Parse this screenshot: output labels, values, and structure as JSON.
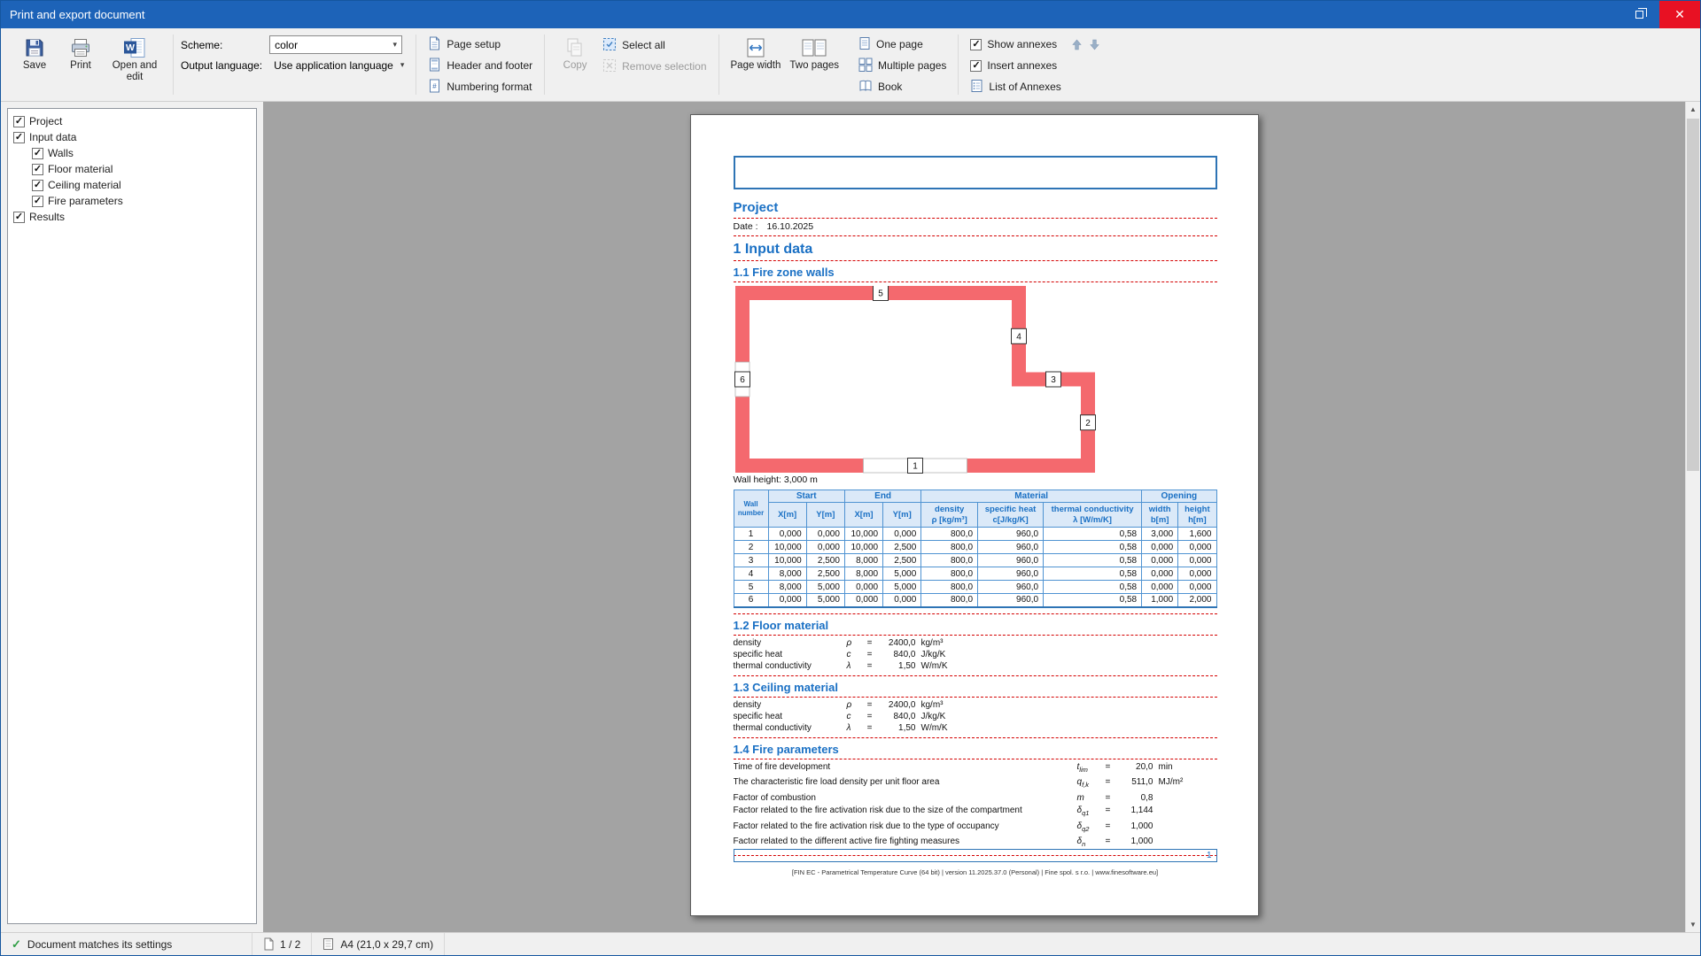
{
  "window": {
    "title": "Print and export document"
  },
  "ribbon": {
    "save": "Save",
    "print": "Print",
    "open_and_edit": "Open and edit",
    "scheme_label": "Scheme:",
    "scheme_value": "color",
    "output_language_label": "Output language:",
    "output_language_value": "Use application language",
    "page_setup": "Page setup",
    "header_and_footer": "Header and footer",
    "numbering_format": "Numbering format",
    "copy": "Copy",
    "select_all": "Select all",
    "remove_selection": "Remove selection",
    "page_width": "Page width",
    "two_pages": "Two pages",
    "one_page": "One page",
    "multiple_pages": "Multiple pages",
    "book": "Book",
    "show_annexes": "Show annexes",
    "insert_annexes": "Insert annexes",
    "list_of_annexes": "List of Annexes"
  },
  "tree": {
    "items": [
      {
        "label": "Project",
        "level": 0,
        "checked": true
      },
      {
        "label": "Input data",
        "level": 0,
        "checked": true
      },
      {
        "label": "Walls",
        "level": 1,
        "checked": true
      },
      {
        "label": "Floor material",
        "level": 1,
        "checked": true
      },
      {
        "label": "Ceiling material",
        "level": 1,
        "checked": true
      },
      {
        "label": "Fire parameters",
        "level": 1,
        "checked": true
      },
      {
        "label": "Results",
        "level": 0,
        "checked": true
      }
    ]
  },
  "doc": {
    "title": "Project",
    "date_label": "Date :",
    "date_value": "16.10.2025",
    "section_input": "1 Input data",
    "section_walls": "1.1 Fire zone walls",
    "diagram_labels": [
      "1",
      "2",
      "3",
      "4",
      "5",
      "6"
    ],
    "wall_height_note": "Wall height: 3,000 m",
    "walls_table": {
      "corner": "Wall number",
      "groups": [
        {
          "label": "Start",
          "span": 2
        },
        {
          "label": "End",
          "span": 2
        },
        {
          "label": "Material",
          "span": 3
        },
        {
          "label": "Opening",
          "span": 2
        }
      ],
      "sub_headers": [
        [
          "X[m]"
        ],
        [
          "Y[m]"
        ],
        [
          "X[m]"
        ],
        [
          "Y[m]"
        ],
        [
          "density",
          "ρ [kg/m³]"
        ],
        [
          "specific heat",
          "c[J/kg/K]"
        ],
        [
          "thermal conductivity",
          "λ [W/m/K]"
        ],
        [
          "width",
          "b[m]"
        ],
        [
          "height",
          "h[m]"
        ]
      ],
      "rows": [
        [
          "1",
          "0,000",
          "0,000",
          "10,000",
          "0,000",
          "800,0",
          "960,0",
          "0,58",
          "3,000",
          "1,600"
        ],
        [
          "2",
          "10,000",
          "0,000",
          "10,000",
          "2,500",
          "800,0",
          "960,0",
          "0,58",
          "0,000",
          "0,000"
        ],
        [
          "3",
          "10,000",
          "2,500",
          "8,000",
          "2,500",
          "800,0",
          "960,0",
          "0,58",
          "0,000",
          "0,000"
        ],
        [
          "4",
          "8,000",
          "2,500",
          "8,000",
          "5,000",
          "800,0",
          "960,0",
          "0,58",
          "0,000",
          "0,000"
        ],
        [
          "5",
          "8,000",
          "5,000",
          "0,000",
          "5,000",
          "800,0",
          "960,0",
          "0,58",
          "0,000",
          "0,000"
        ],
        [
          "6",
          "0,000",
          "5,000",
          "0,000",
          "0,000",
          "800,0",
          "960,0",
          "0,58",
          "1,000",
          "2,000"
        ]
      ]
    },
    "section_floor": "1.2 Floor material",
    "floor_material": [
      {
        "name": "density",
        "symbol": "ρ",
        "value": "2400,0",
        "unit": "kg/m³"
      },
      {
        "name": "specific heat",
        "symbol": "c",
        "value": "840,0",
        "unit": "J/kg/K"
      },
      {
        "name": "thermal conductivity",
        "symbol": "λ",
        "value": "1,50",
        "unit": "W/m/K"
      }
    ],
    "section_ceiling": "1.3 Ceiling material",
    "ceiling_material": [
      {
        "name": "density",
        "symbol": "ρ",
        "value": "2400,0",
        "unit": "kg/m³"
      },
      {
        "name": "specific heat",
        "symbol": "c",
        "value": "840,0",
        "unit": "J/kg/K"
      },
      {
        "name": "thermal conductivity",
        "symbol": "λ",
        "value": "1,50",
        "unit": "W/m/K"
      }
    ],
    "section_fire": "1.4 Fire parameters",
    "fire_parameters": [
      {
        "name": "Time of fire development",
        "symbol": "t",
        "sub": "lim",
        "value": "20,0",
        "unit": "min"
      },
      {
        "name": "The characteristic fire load density per unit floor area",
        "symbol": "q",
        "sub": "f,k",
        "value": "511,0",
        "unit": "MJ/m²"
      },
      {
        "name": "Factor of combustion",
        "symbol": "m",
        "sub": "",
        "value": "0,8",
        "unit": ""
      },
      {
        "name": "Factor related to the fire activation risk due to the size of the compartment",
        "symbol": "δ",
        "sub": "q1",
        "value": "1,144",
        "unit": ""
      },
      {
        "name": "Factor related to the fire activation risk due to the type of occupancy",
        "symbol": "δ",
        "sub": "q2",
        "value": "1,000",
        "unit": ""
      },
      {
        "name": "Factor related to the different active fire fighting measures",
        "symbol": "δ",
        "sub": "n",
        "value": "1,000",
        "unit": ""
      }
    ],
    "page_number": "1",
    "footer_text": "[FIN EC - Parametrical Temperature Curve (64 bit) | version 11.2025.37.0 (Personal) | Fine spol. s r.o. | www.finesoftware.eu]"
  },
  "statusbar": {
    "status": "Document matches its settings",
    "pages": "1 / 2",
    "paper": "A4 (21,0 x 29,7 cm)"
  },
  "colors": {
    "titlebar": "#1d63b8",
    "accent_blue": "#1a70c4",
    "wall_red": "#f4696e",
    "dashed_red": "#d40000"
  }
}
